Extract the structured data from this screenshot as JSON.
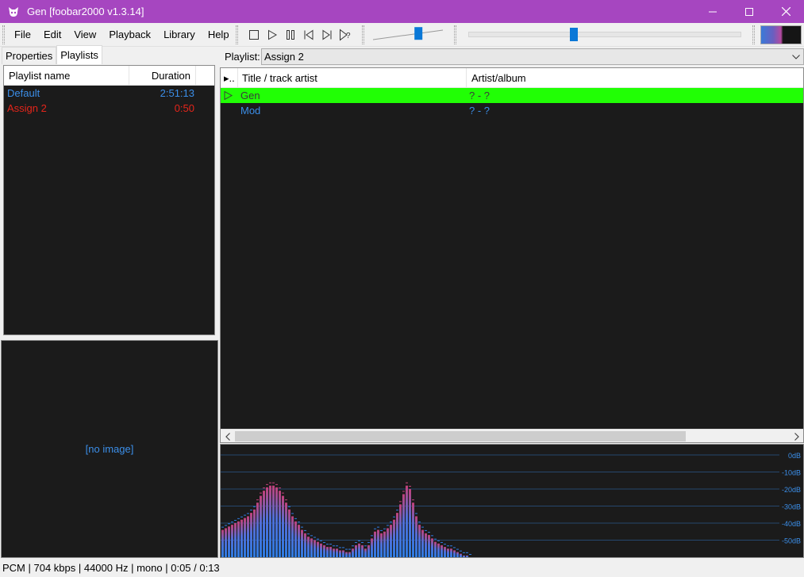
{
  "window": {
    "title": "Gen  [foobar2000 v1.3.14]",
    "title_bar_color": "#a646c0"
  },
  "menu": {
    "items": [
      "File",
      "Edit",
      "View",
      "Playback",
      "Library",
      "Help"
    ]
  },
  "transport": {
    "buttons": [
      "stop-icon",
      "play-icon",
      "pause-icon",
      "previous-icon",
      "next-icon",
      "random-icon"
    ]
  },
  "volume": {
    "level": 0.65
  },
  "seek": {
    "position": 0.3846
  },
  "left_tabs": {
    "properties": "Properties",
    "playlists": "Playlists",
    "active": "playlists"
  },
  "playlist_manager": {
    "col_name": "Playlist name",
    "col_duration": "Duration",
    "rows": [
      {
        "name": "Default",
        "duration": "2:51:13",
        "color": "#3b8ee8"
      },
      {
        "name": "Assign 2",
        "duration": "0:50",
        "color": "#e5251b"
      }
    ]
  },
  "album_art": {
    "placeholder": "[no image]"
  },
  "playlist_selector": {
    "label": "Playlist:",
    "value": "Assign 2"
  },
  "playlist_view": {
    "col_playing": "▸..",
    "col_title": "Title / track artist",
    "col_artist": "Artist/album",
    "rows": [
      {
        "title": "Gen",
        "artist_album": "? - ?",
        "playing": true
      },
      {
        "title": "Mod",
        "artist_album": "? - ?",
        "playing": false
      }
    ],
    "playing_color": "#21ff05",
    "text_color": "#3b8ee8"
  },
  "spectrum": {
    "db_labels": [
      "0dB",
      "-10dB",
      "-20dB",
      "-30dB",
      "-40dB",
      "-50dB"
    ],
    "bar_levels_db": [
      -44,
      -43,
      -42,
      -41,
      -40,
      -39,
      -38,
      -37,
      -36,
      -34,
      -32,
      -28,
      -24,
      -21,
      -19,
      -18,
      -18,
      -19,
      -21,
      -24,
      -28,
      -32,
      -36,
      -39,
      -41,
      -44,
      -46,
      -48,
      -49,
      -50,
      -51,
      -52,
      -53,
      -54,
      -54,
      -55,
      -55,
      -56,
      -56,
      -57,
      -57,
      -55,
      -53,
      -52,
      -53,
      -55,
      -53,
      -49,
      -45,
      -44,
      -46,
      -45,
      -43,
      -41,
      -38,
      -34,
      -29,
      -23,
      -18,
      -20,
      -28,
      -36,
      -41,
      -44,
      -46,
      -47,
      -49,
      -51,
      -52,
      -53,
      -54,
      -55,
      -55,
      -56,
      -57,
      -58,
      -59,
      -59,
      -60
    ],
    "bar_color_low": "#2e7be0",
    "bar_color_high": "#c2417a",
    "grid_color": "#26476e"
  },
  "status": {
    "text": "PCM | 704 kbps | 44000 Hz | mono | 0:05 / 0:13"
  }
}
